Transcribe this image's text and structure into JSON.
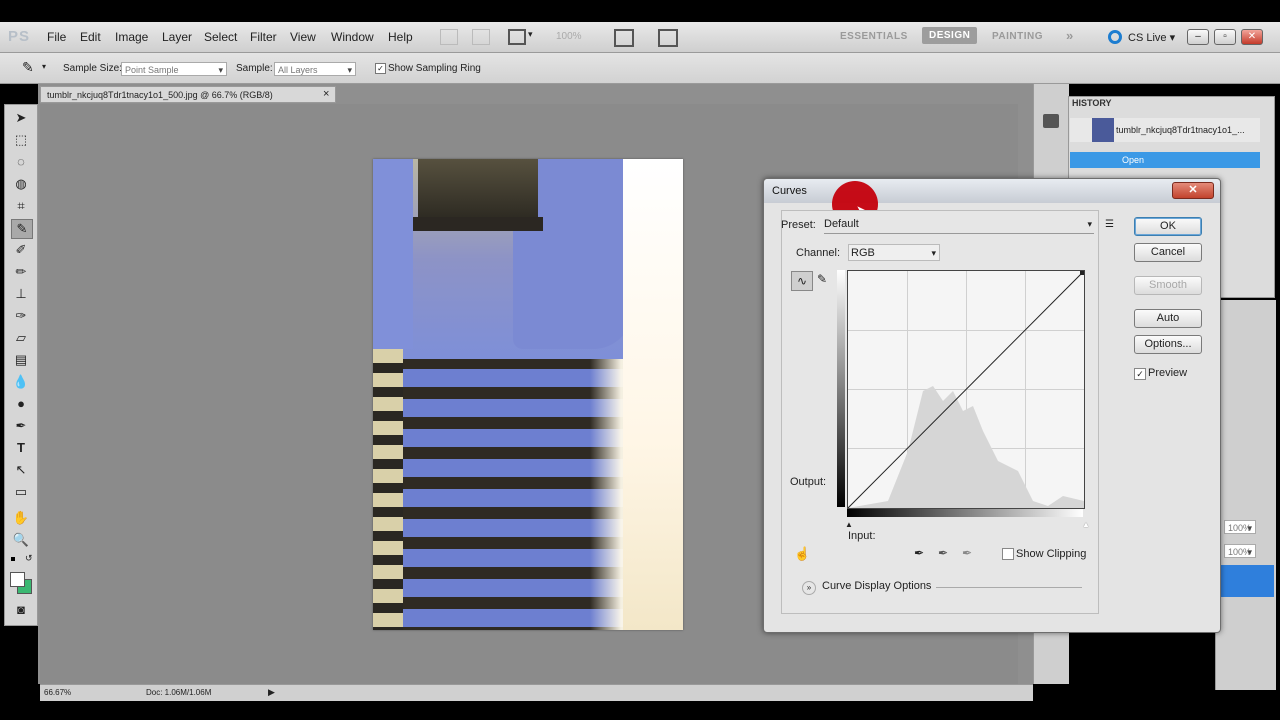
{
  "app": {
    "logo": "PS"
  },
  "menu": [
    "File",
    "Edit",
    "Image",
    "Layer",
    "Select",
    "Filter",
    "View",
    "Window",
    "Help"
  ],
  "toolbar_zoom": "100%",
  "workspaces": {
    "essentials": "ESSENTIALS",
    "design": "DESIGN",
    "painting": "PAINTING",
    "more": "»"
  },
  "cslive": "CS Live ▾",
  "options": {
    "sample_size_label": "Sample Size:",
    "sample_size_value": "Point Sample",
    "sample_label": "Sample:",
    "sample_value": "All Layers",
    "show_ring": "Show Sampling Ring"
  },
  "document": {
    "tab_title": "tumblr_nkcjuq8Tdr1tnacy1o1_500.jpg @ 66.7% (RGB/8)",
    "tab_close": "×",
    "zoom": "66.67%",
    "doc_info": "Doc: 1.06M/1.06M"
  },
  "history": {
    "title": "HISTORY",
    "snapshot": "tumblr_nkcjuq8Tdr1tnacy1o1_...",
    "step": "Open"
  },
  "right_values": [
    "100%",
    "100%"
  ],
  "curves": {
    "title": "Curves",
    "close": "✕",
    "preset_label": "Preset:",
    "preset_value": "Default",
    "channel_label": "Channel:",
    "channel_value": "RGB",
    "output_label": "Output:",
    "input_label": "Input:",
    "show_clipping": "Show Clipping",
    "display_options": "Curve Display Options",
    "buttons": {
      "ok": "OK",
      "cancel": "Cancel",
      "smooth": "Smooth",
      "auto": "Auto",
      "options": "Options..."
    },
    "preview": "Preview"
  }
}
